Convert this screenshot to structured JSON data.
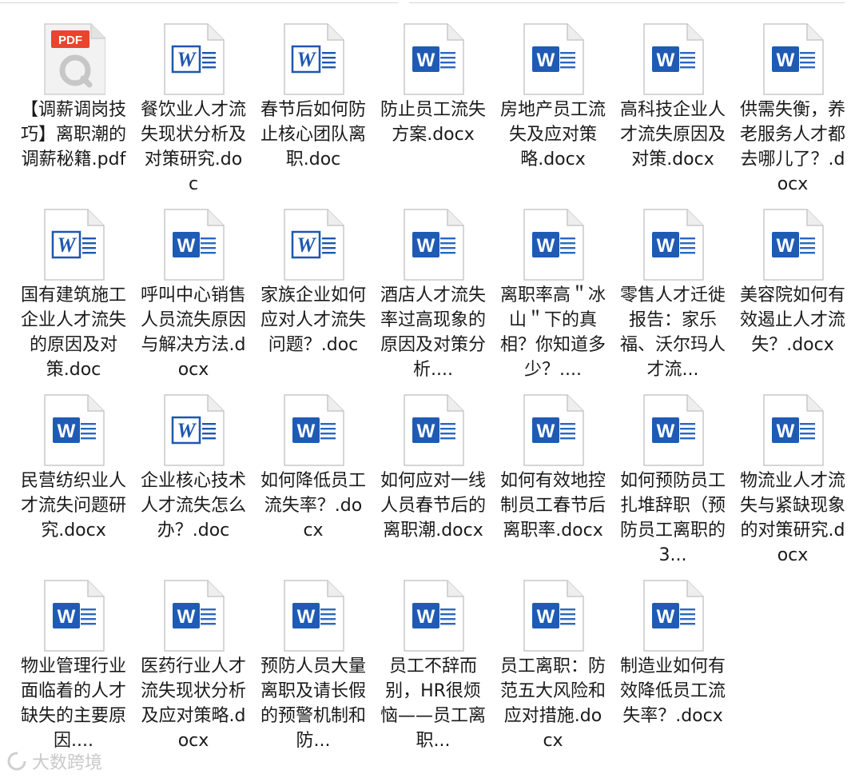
{
  "files": [
    {
      "name": "【调薪调岗技巧】离职潮的调薪秘籍.pdf",
      "icon": "pdf"
    },
    {
      "name": "餐饮业人才流失现状分析及对策研究.doc",
      "icon": "doc"
    },
    {
      "name": "春节后如何防止核心团队离职.doc",
      "icon": "doc"
    },
    {
      "name": "防止员工流失方案.docx",
      "icon": "docx"
    },
    {
      "name": "房地产员工流失及应对策略.docx",
      "icon": "docx"
    },
    {
      "name": "高科技企业人才流失原因及对策.docx",
      "icon": "docx"
    },
    {
      "name": "供需失衡，养老服务人才都去哪儿了？.docx",
      "icon": "docx"
    },
    {
      "name": "国有建筑施工企业人才流失的原因及对策.doc",
      "icon": "doc"
    },
    {
      "name": "呼叫中心销售人员流失原因与解决方法.docx",
      "icon": "docx"
    },
    {
      "name": "家族企业如何应对人才流失问题？.doc",
      "icon": "doc"
    },
    {
      "name": "酒店人才流失率过高现象的原因及对策分析....",
      "icon": "docx"
    },
    {
      "name": "离职率高＂冰山＂下的真相？你知道多少？....",
      "icon": "docx"
    },
    {
      "name": "零售人才迁徙报告：家乐福、沃尔玛人才流...",
      "icon": "docx"
    },
    {
      "name": "美容院如何有效遏止人才流失？.docx",
      "icon": "docx"
    },
    {
      "name": "民营纺织业人才流失问题研究.docx",
      "icon": "docx"
    },
    {
      "name": "企业核心技术人才流失怎么办？.doc",
      "icon": "doc"
    },
    {
      "name": "如何降低员工流失率？.docx",
      "icon": "docx"
    },
    {
      "name": "如何应对一线人员春节后的离职潮.docx",
      "icon": "docx"
    },
    {
      "name": "如何有效地控制员工春节后离职率.docx",
      "icon": "docx"
    },
    {
      "name": "如何预防员工扎堆辞职（预防员工离职的3...",
      "icon": "docx"
    },
    {
      "name": "物流业人才流失与紧缺现象的对策研究.docx",
      "icon": "docx"
    },
    {
      "name": "物业管理行业面临着的人才缺失的主要原因....",
      "icon": "docx"
    },
    {
      "name": "医药行业人才流失现状分析及应对策略.docx",
      "icon": "docx"
    },
    {
      "name": "预防人员大量离职及请长假的预警机制和防...",
      "icon": "docx"
    },
    {
      "name": "员工不辞而别，HR很烦恼——员工离职...",
      "icon": "docx"
    },
    {
      "name": "员工离职：防范五大风险和应对措施.docx",
      "icon": "docx"
    },
    {
      "name": "制造业如何有效降低员工流失率？.docx",
      "icon": "docx"
    }
  ],
  "watermark": {
    "text": "大数跨境"
  },
  "colors": {
    "word_blue": "#1f5bb5",
    "pdf_red": "#e8442e",
    "doc_blue": "#1d57b0"
  }
}
